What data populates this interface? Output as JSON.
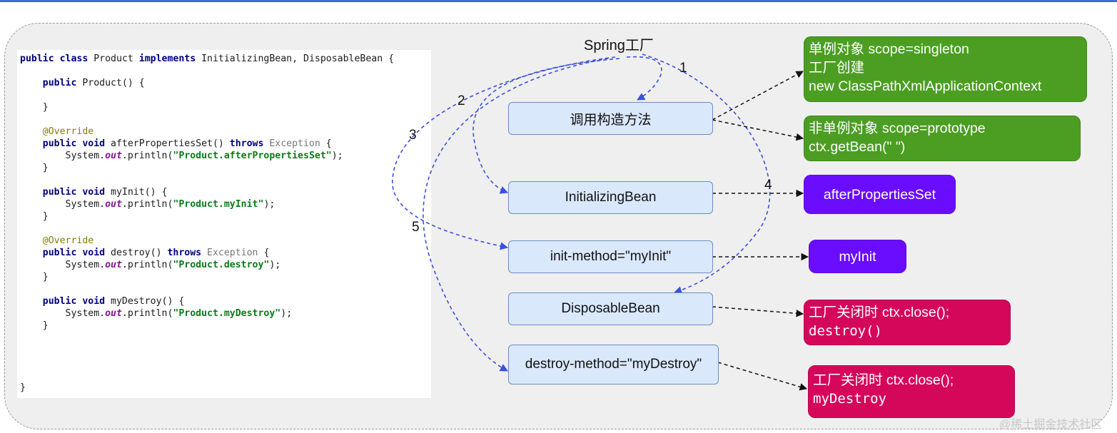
{
  "title": "Spring工厂",
  "code": {
    "lines": [
      [
        [
          "kw",
          "public class "
        ],
        [
          "",
          "Product "
        ],
        [
          "kw",
          "implements "
        ],
        [
          "",
          "InitializingBean, DisposableBean {"
        ]
      ],
      [],
      [
        [
          "",
          "    "
        ],
        [
          "kw",
          "public "
        ],
        [
          "",
          "Product() {"
        ]
      ],
      [],
      [
        [
          "",
          "    }"
        ]
      ],
      [],
      [
        [
          "",
          "    "
        ],
        [
          "an",
          "@Override"
        ]
      ],
      [
        [
          "",
          "    "
        ],
        [
          "kw",
          "public void "
        ],
        [
          "",
          "afterPropertiesSet() "
        ],
        [
          "kw",
          "throws "
        ],
        [
          "ex",
          "Exception "
        ],
        [
          "",
          "{"
        ]
      ],
      [
        [
          "",
          "        System."
        ],
        [
          "fi",
          "out"
        ],
        [
          "",
          ".println("
        ],
        [
          "st",
          "\"Product.afterPropertiesSet\""
        ],
        [
          "",
          ");"
        ]
      ],
      [
        [
          "",
          "    }"
        ]
      ],
      [],
      [
        [
          "",
          "    "
        ],
        [
          "kw",
          "public void "
        ],
        [
          "",
          "myInit() {"
        ]
      ],
      [
        [
          "",
          "        System."
        ],
        [
          "fi",
          "out"
        ],
        [
          "",
          ".println("
        ],
        [
          "st",
          "\"Product.myInit\""
        ],
        [
          "",
          ");"
        ]
      ],
      [
        [
          "",
          "    }"
        ]
      ],
      [],
      [
        [
          "",
          "    "
        ],
        [
          "an",
          "@Override"
        ]
      ],
      [
        [
          "",
          "    "
        ],
        [
          "kw",
          "public void "
        ],
        [
          "",
          "destroy() "
        ],
        [
          "kw",
          "throws "
        ],
        [
          "ex",
          "Exception "
        ],
        [
          "",
          "{"
        ]
      ],
      [
        [
          "",
          "        System."
        ],
        [
          "fi",
          "out"
        ],
        [
          "",
          ".println("
        ],
        [
          "st",
          "\"Product.destroy\""
        ],
        [
          "",
          ");"
        ]
      ],
      [
        [
          "",
          "    }"
        ]
      ],
      [],
      [
        [
          "",
          "    "
        ],
        [
          "kw",
          "public void "
        ],
        [
          "",
          "myDestroy() {"
        ]
      ],
      [
        [
          "",
          "        System."
        ],
        [
          "fi",
          "out"
        ],
        [
          "",
          ".println("
        ],
        [
          "st",
          "\"Product.myDestroy\""
        ],
        [
          "",
          ");"
        ]
      ],
      [
        [
          "",
          "    }"
        ]
      ]
    ],
    "closing": "}"
  },
  "numbers": [
    "1",
    "2",
    "3",
    "4",
    "5"
  ],
  "boxes": {
    "constructor": "调用构造方法",
    "initializing_bean": "InitializingBean",
    "init_method": "init-method=\"myInit\"",
    "disposable_bean": "DisposableBean",
    "destroy_method": "destroy-method=\"myDestroy\""
  },
  "notes": {
    "singleton": [
      "单例对象 scope=singleton",
      "工厂创建",
      "new ClassPathXmlApplicationContext"
    ],
    "prototype": [
      "非单例对象 scope=prototype",
      "ctx.getBean(\"  \")"
    ],
    "after_properties_set": "afterPropertiesSet",
    "my_init": "myInit",
    "destroy": [
      "工厂关闭时 ctx.close();",
      "destroy()"
    ],
    "my_destroy": [
      "工厂关闭时 ctx.close();",
      "myDestroy"
    ]
  },
  "colors": {
    "box_fill": "#dae8fc",
    "box_border": "#6c8ebf",
    "green": "#4b9e22",
    "purple": "#6a0dff",
    "magenta": "#d5075b",
    "flow_arrow": "#3b4fe0"
  },
  "watermark": "@稀土掘金技术社区"
}
